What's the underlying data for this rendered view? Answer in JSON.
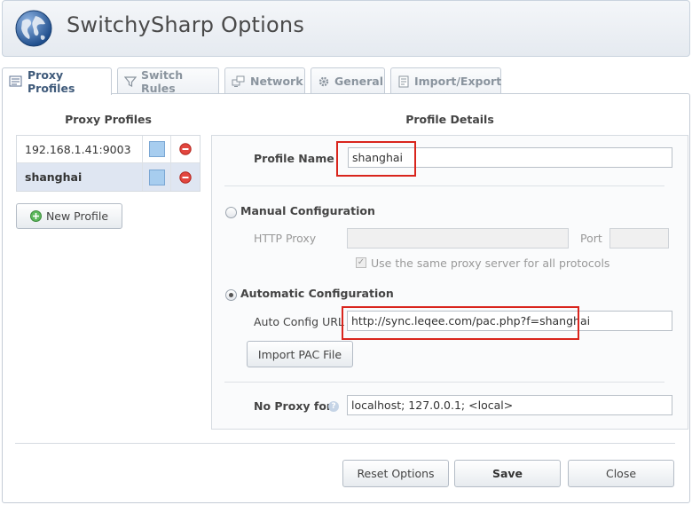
{
  "header": {
    "title": "SwitchySharp Options",
    "logo_icon": "globe-icon"
  },
  "tabs": [
    {
      "label": "Proxy Profiles",
      "icon": "profiles-icon",
      "active": true
    },
    {
      "label": "Switch Rules",
      "icon": "filter-icon",
      "active": false
    },
    {
      "label": "Network",
      "icon": "network-icon",
      "active": false
    },
    {
      "label": "General",
      "icon": "gear-icon",
      "active": false
    },
    {
      "label": "Import/Export",
      "icon": "document-icon",
      "active": false
    }
  ],
  "profiles_panel": {
    "title": "Proxy Profiles",
    "profiles": [
      {
        "name": "192.168.1.41:9003",
        "color": "#a7cdef",
        "selected": false
      },
      {
        "name": "shanghai",
        "color": "#a7cdef",
        "selected": true
      }
    ],
    "new_profile_label": "New Profile"
  },
  "details": {
    "title": "Profile Details",
    "profile_name_label": "Profile Name",
    "profile_name_value": "shanghai",
    "manual": {
      "label": "Manual Configuration",
      "checked": false,
      "http_proxy_label": "HTTP Proxy",
      "http_proxy_value": "",
      "port_label": "Port",
      "port_value": "",
      "same_proxy_label": "Use the same proxy server for all protocols",
      "same_proxy_checked": true
    },
    "automatic": {
      "label": "Automatic Configuration",
      "checked": true,
      "auto_config_url_label": "Auto Config URL",
      "auto_config_url_value": "http://sync.leqee.com/pac.php?f=shanghai",
      "import_pac_label": "Import PAC File"
    },
    "no_proxy_label": "No Proxy for",
    "no_proxy_value": "localhost; 127.0.0.1; <local>"
  },
  "footer": {
    "reset_label": "Reset Options",
    "save_label": "Save",
    "close_label": "Close"
  },
  "colors": {
    "highlight": "#d9251d",
    "accent": "#3f5a7a"
  }
}
